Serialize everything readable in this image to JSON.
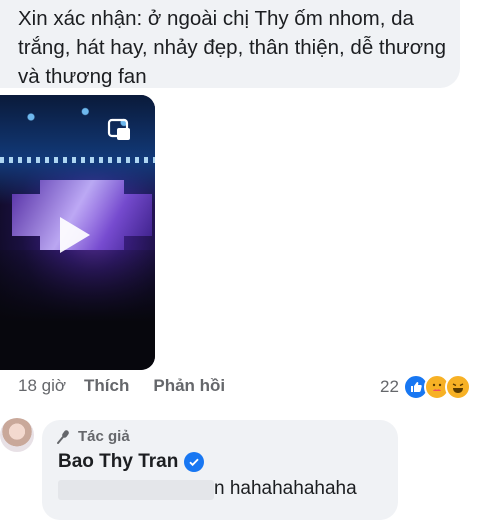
{
  "comment": {
    "text": "Xin xác nhận: ở ngoài chị Thy ốm nhom, da trắng, hát hay, nhảy đẹp, thân thiện, dễ thương và thương fan"
  },
  "actions": {
    "time": "18 giờ",
    "like_label": "Thích",
    "reply_label": "Phản hồi"
  },
  "reactions": {
    "count": "22",
    "types": [
      "like-icon",
      "care-icon",
      "haha-icon"
    ]
  },
  "reply": {
    "badge_label": "Tác giả",
    "author": "Bao Thy Tran",
    "text": "n hahahahahaha"
  },
  "colors": {
    "bubble": "#f0f2f5",
    "accent": "#1877f2",
    "muted": "#65676b"
  }
}
